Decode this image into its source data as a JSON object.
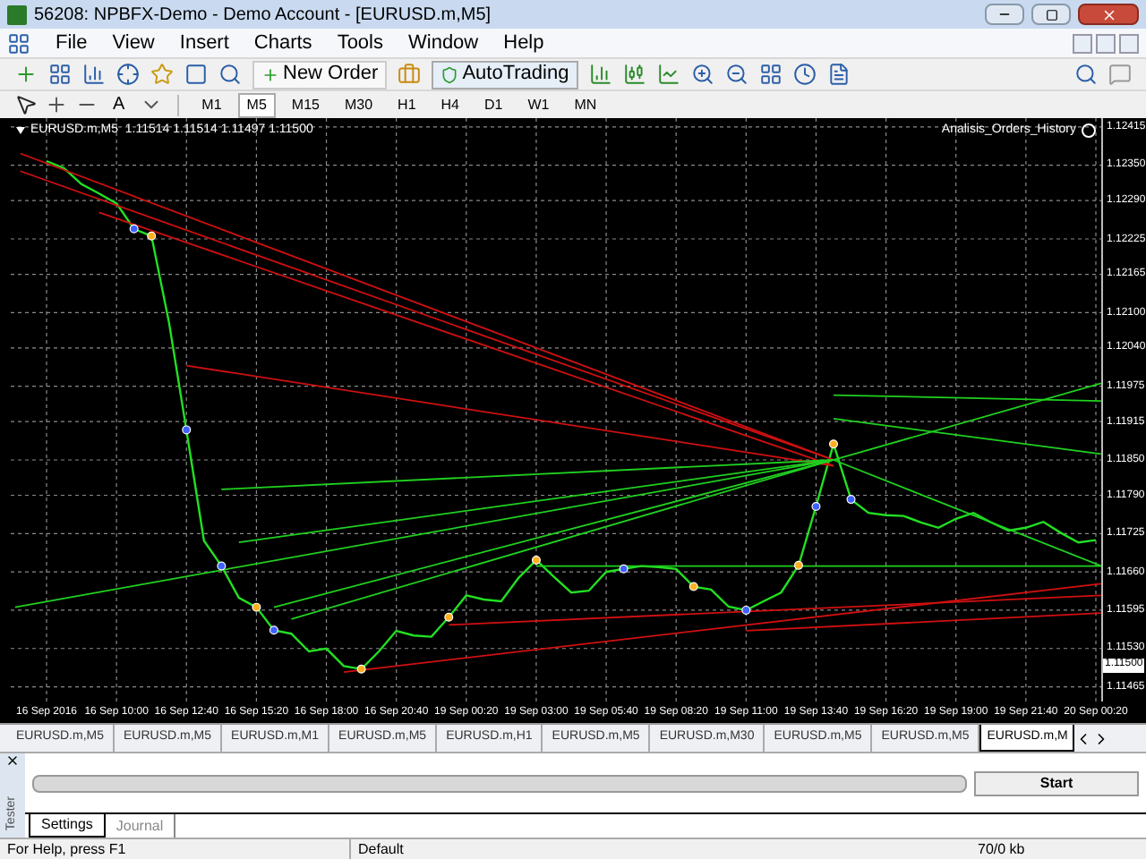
{
  "window": {
    "title": "56208: NPBFX-Demo - Demo Account - [EURUSD.m,M5]"
  },
  "menu": [
    "File",
    "View",
    "Insert",
    "Charts",
    "Tools",
    "Window",
    "Help"
  ],
  "toolbar": {
    "new_order": "New Order",
    "autotrading": "AutoTrading",
    "text_tool": "A"
  },
  "timeframes": [
    {
      "label": "M1",
      "selected": false
    },
    {
      "label": "M5",
      "selected": true
    },
    {
      "label": "M15",
      "selected": false
    },
    {
      "label": "M30",
      "selected": false
    },
    {
      "label": "H1",
      "selected": false
    },
    {
      "label": "H4",
      "selected": false
    },
    {
      "label": "D1",
      "selected": false
    },
    {
      "label": "W1",
      "selected": false
    },
    {
      "label": "MN",
      "selected": false
    }
  ],
  "chart": {
    "symbol_info": "EURUSD.m,M5  1.11514 1.11514 1.11497 1.11500",
    "indicator": "Analisis_Orders_History",
    "current_price": "1.11500",
    "chart_data": {
      "type": "line",
      "categories": [
        "16 Sep 2016",
        null,
        null,
        null,
        "16 Sep 10:00",
        null,
        null,
        null,
        "16 Sep 12:40",
        null,
        null,
        null,
        "16 Sep 15:20",
        null,
        null,
        null,
        "16 Sep 18:00",
        null,
        null,
        null,
        "16 Sep 20:40",
        null,
        null,
        null,
        "19 Sep 00:20",
        null,
        null,
        null,
        "19 Sep 03:00",
        null,
        null,
        null,
        "19 Sep 05:40",
        null,
        null,
        null,
        "19 Sep 08:20",
        null,
        null,
        null,
        "19 Sep 11:00",
        null,
        null,
        null,
        "19 Sep 13:40",
        null,
        null,
        null,
        "19 Sep 16:20",
        null,
        null,
        null,
        "19 Sep 19:00",
        null,
        null,
        null,
        "19 Sep 21:40",
        null,
        null,
        null,
        "20 Sep 00:20"
      ],
      "series": [
        {
          "color": "#22e022",
          "values": [
            1.12357,
            1.12345,
            1.12318,
            1.12302,
            1.12285,
            1.12242,
            1.1223,
            1.12083,
            1.11901,
            1.11713,
            1.1167,
            1.11616,
            1.116,
            1.11561,
            1.11555,
            1.11525,
            1.1153,
            1.115,
            1.11495,
            1.11525,
            1.1156,
            1.11552,
            1.1155,
            1.11583,
            1.1162,
            1.11613,
            1.1161,
            1.1165,
            1.1168,
            1.11652,
            1.11625,
            1.11628,
            1.1166,
            1.11665,
            1.1167,
            1.11668,
            1.11665,
            1.11635,
            1.1163,
            1.11601,
            1.11595,
            1.1161,
            1.11625,
            1.11671,
            1.11771,
            1.11877,
            1.11783,
            1.1176,
            1.11756,
            1.11755,
            1.11744,
            1.11735,
            1.1175,
            1.1176,
            1.11744,
            1.1173,
            1.11735,
            1.11745,
            1.11726,
            1.1171,
            1.11714
          ]
        }
      ],
      "ylim": [
        1.1144,
        1.1243
      ],
      "grid": true,
      "yticks": [
        {
          "value": 1.12415,
          "label": "1.12415"
        },
        {
          "value": 1.1235,
          "label": "1.12350"
        },
        {
          "value": 1.1229,
          "label": "1.12290"
        },
        {
          "value": 1.12225,
          "label": "1.12225"
        },
        {
          "value": 1.12165,
          "label": "1.12165"
        },
        {
          "value": 1.121,
          "label": "1.12100"
        },
        {
          "value": 1.1204,
          "label": "1.12040"
        },
        {
          "value": 1.11975,
          "label": "1.11975"
        },
        {
          "value": 1.11915,
          "label": "1.11915"
        },
        {
          "value": 1.1185,
          "label": "1.11850"
        },
        {
          "value": 1.1179,
          "label": "1.11790"
        },
        {
          "value": 1.11725,
          "label": "1.11725"
        },
        {
          "value": 1.1166,
          "label": "1.11660"
        },
        {
          "value": 1.11595,
          "label": "1.11595"
        },
        {
          "value": 1.1153,
          "label": "1.11530"
        },
        {
          "value": 1.11465,
          "label": "1.11465"
        }
      ]
    }
  },
  "chart_tabs": [
    {
      "label": "EURUSD.m,M5",
      "selected": false
    },
    {
      "label": "EURUSD.m,M5",
      "selected": false
    },
    {
      "label": "EURUSD.m,M1",
      "selected": false
    },
    {
      "label": "EURUSD.m,M5",
      "selected": false
    },
    {
      "label": "EURUSD.m,H1",
      "selected": false
    },
    {
      "label": "EURUSD.m,M5",
      "selected": false
    },
    {
      "label": "EURUSD.m,M30",
      "selected": false
    },
    {
      "label": "EURUSD.m,M5",
      "selected": false
    },
    {
      "label": "EURUSD.m,M5",
      "selected": false
    },
    {
      "label": "EURUSD.m,M",
      "selected": true
    }
  ],
  "tester": {
    "title": "Tester",
    "progress": {
      "level": 0
    },
    "start_button": "Start",
    "tabs": [
      {
        "label": "Settings",
        "selected": true
      },
      {
        "label": "Journal",
        "selected": false
      }
    ]
  },
  "status_bar": [
    "For Help, press F1",
    "Default",
    "70/0 kb"
  ]
}
